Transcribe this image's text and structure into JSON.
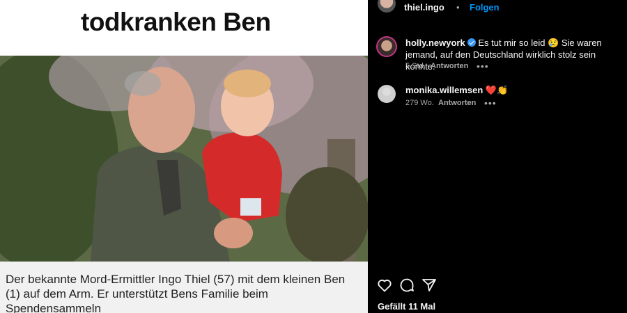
{
  "post": {
    "headline": "todkranken Ben",
    "caption": "Der bekannte Mord-Ermittler Ingo Thiel (57) mit dem kleinen Ben (1) auf dem Arm. Er unterstützt Bens Familie beim Spendensammeln"
  },
  "header": {
    "username": "thiel.ingo",
    "separator": "•",
    "follow_label": "Folgen"
  },
  "comments": [
    {
      "username": "holly.newyork",
      "verified": true,
      "text": "Es tut mir so leid 😢 Sie waren jemand, auf den Deutschland wirklich stolz sein konnte.",
      "time": "5 Std.",
      "reply_label": "Antworten",
      "more": "•••"
    },
    {
      "username": "monika.willemsen",
      "text": "❤️👏",
      "time": "279 Wo.",
      "reply_label": "Antworten",
      "more": "•••"
    }
  ],
  "actions": {
    "icons": [
      "heart-icon",
      "comment-icon",
      "share-icon"
    ],
    "likes_text": "Gefällt 11 Mal"
  }
}
